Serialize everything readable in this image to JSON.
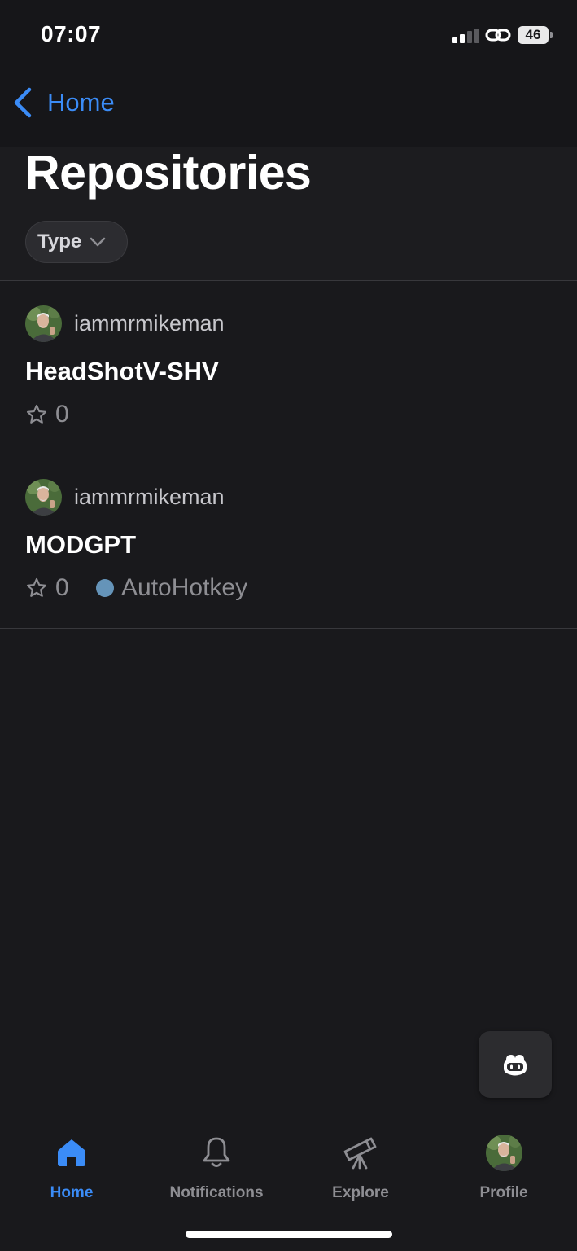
{
  "status_bar": {
    "time": "07:07",
    "battery": "46",
    "signal_icon": "cellular-signal-icon",
    "link_icon": "personal-hotspot-link-icon"
  },
  "nav": {
    "back_label": "Home",
    "back_icon": "chevron-left-icon"
  },
  "page": {
    "title": "Repositories"
  },
  "filters": {
    "type_label": "Type",
    "chevron_icon": "chevron-down-icon"
  },
  "repositories": [
    {
      "owner": "iammrmikeman",
      "name": "HeadShotV-SHV",
      "stars": "0",
      "language": ""
    },
    {
      "owner": "iammrmikeman",
      "name": "MODGPT",
      "stars": "0",
      "language": "AutoHotkey",
      "language_color": "#6594b9"
    }
  ],
  "copilot": {
    "icon": "copilot-icon"
  },
  "tabs": [
    {
      "label": "Home",
      "icon": "home-icon",
      "active": true
    },
    {
      "label": "Notifications",
      "icon": "bell-icon",
      "active": false
    },
    {
      "label": "Explore",
      "icon": "telescope-icon",
      "active": false
    },
    {
      "label": "Profile",
      "icon": "avatar",
      "active": false
    }
  ],
  "colors": {
    "accent": "#3b8cf7",
    "background": "#19191c",
    "secondary_text": "#8e8e93"
  }
}
